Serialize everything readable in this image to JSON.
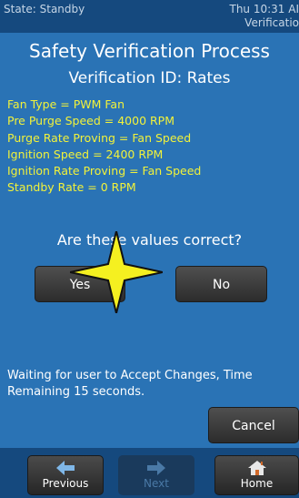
{
  "status": {
    "state": "State: Standby",
    "time_line1": "Thu 10:31 AI",
    "time_line2": "Verificatio"
  },
  "screen": {
    "title": "Safety Verification Process",
    "subtitle": "Verification ID: Rates"
  },
  "values": [
    "Fan Type = PWM Fan",
    "Pre Purge Speed = 4000 RPM",
    "Purge Rate Proving = Fan Speed",
    "Ignition Speed = 2400 RPM",
    "Ignition Rate Proving = Fan Speed",
    "Standby Rate = 0 RPM"
  ],
  "question": "Are these values correct?",
  "buttons": {
    "yes": "Yes",
    "no": "No",
    "cancel": "Cancel"
  },
  "wait_message": "Waiting for user to Accept Changes, Time Remaining 15 seconds.",
  "nav": {
    "previous": "Previous",
    "next": "Next",
    "home": "Home"
  },
  "icons": {
    "previous": "arrow-left-icon",
    "next": "arrow-right-icon",
    "home": "home-icon",
    "annotation": "star-marker-icon"
  },
  "colors": {
    "background": "#2a73b5",
    "bar": "#15497e",
    "values_text": "#f2f23a",
    "button": "#3a3a3a",
    "star": "#f5f020"
  }
}
